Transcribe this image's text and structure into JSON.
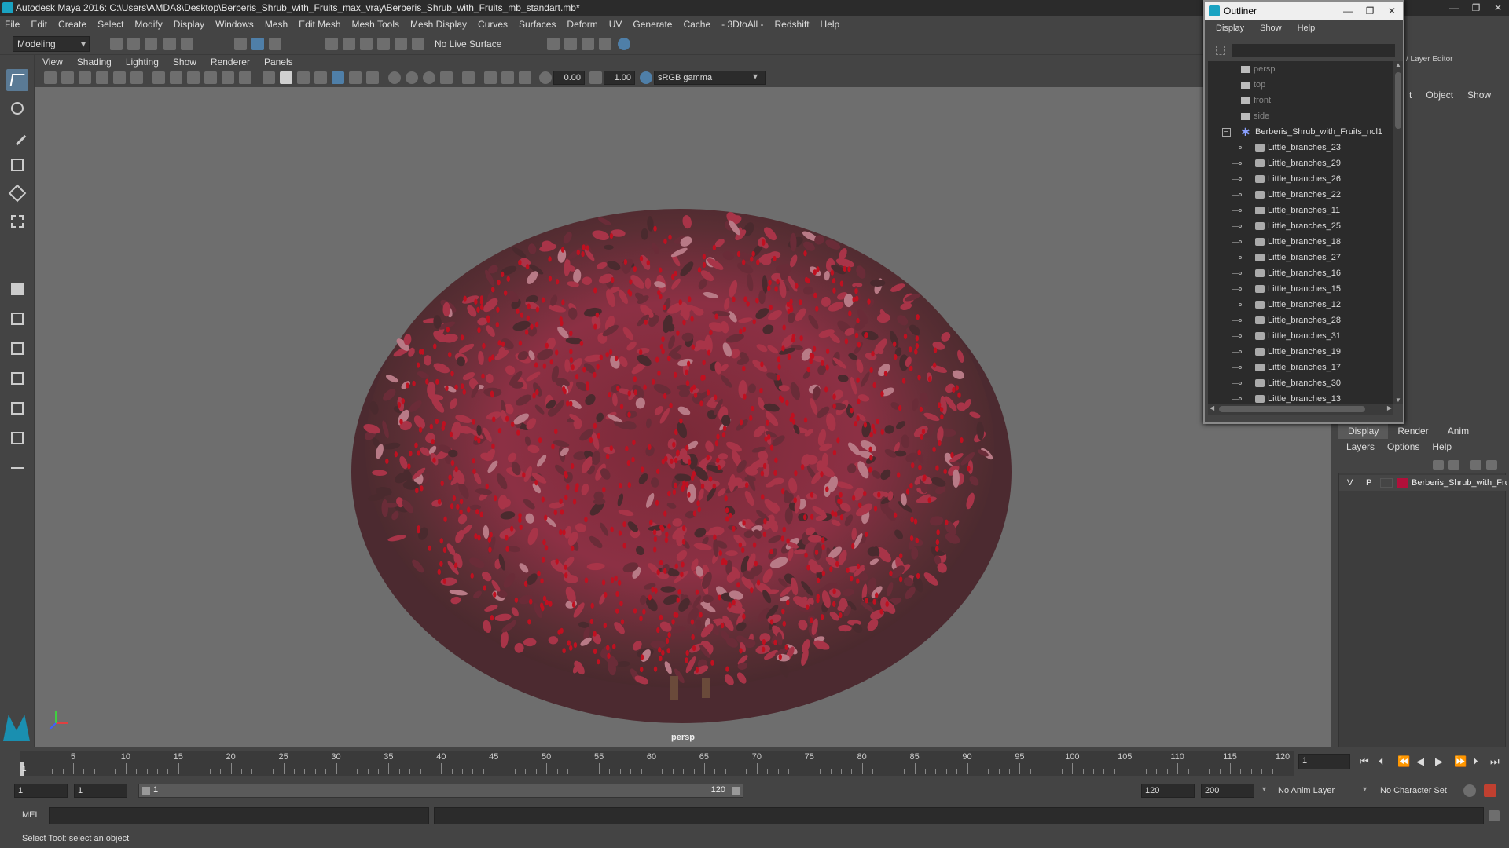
{
  "title": "Autodesk Maya 2016: C:\\Users\\AMDA8\\Desktop\\Berberis_Shrub_with_Fruits_max_vray\\Berberis_Shrub_with_Fruits_mb_standart.mb*",
  "window_controls": [
    "—",
    "❐",
    "✕"
  ],
  "menubar": [
    "File",
    "Edit",
    "Create",
    "Select",
    "Modify",
    "Display",
    "Windows",
    "Mesh",
    "Edit Mesh",
    "Mesh Tools",
    "Mesh Display",
    "Curves",
    "Surfaces",
    "Deform",
    "UV",
    "Generate",
    "Cache",
    "- 3DtoAll -",
    "Redshift",
    "Help"
  ],
  "status": {
    "mode": "Modeling",
    "live_surface": "No Live Surface"
  },
  "viewport_menu": [
    "View",
    "Shading",
    "Lighting",
    "Show",
    "Renderer",
    "Panels"
  ],
  "viewport_toolbar": {
    "near_value": "0.00",
    "gamma_value": "1.00",
    "color_space": "sRGB gamma"
  },
  "viewport": {
    "camera_label": "persp"
  },
  "outliner": {
    "title": "Outliner",
    "menu": [
      "Display",
      "Show",
      "Help"
    ],
    "cameras": [
      "persp",
      "top",
      "front",
      "side"
    ],
    "group": "Berberis_Shrub_with_Fruits_ncl1",
    "children": [
      "Little_branches_23",
      "Little_branches_29",
      "Little_branches_26",
      "Little_branches_22",
      "Little_branches_11",
      "Little_branches_25",
      "Little_branches_18",
      "Little_branches_27",
      "Little_branches_16",
      "Little_branches_15",
      "Little_branches_12",
      "Little_branches_28",
      "Little_branches_31",
      "Little_branches_19",
      "Little_branches_17",
      "Little_branches_30",
      "Little_branches_13"
    ]
  },
  "right_panel": {
    "layer_editor_label": "/ Layer Editor",
    "menu_top": [
      "t",
      "Object",
      "Show"
    ],
    "tabs": [
      "Display",
      "Render",
      "Anim"
    ],
    "layer_menu": [
      "Layers",
      "Options",
      "Help"
    ],
    "layer": {
      "v": "V",
      "p": "P",
      "name": "Berberis_Shrub_with_Fruits",
      "color": "#b0103a"
    }
  },
  "timeline": {
    "ticks": [
      5,
      10,
      15,
      20,
      25,
      30,
      35,
      40,
      45,
      50,
      55,
      60,
      65,
      70,
      75,
      80,
      85,
      90,
      95,
      100,
      105,
      110,
      115,
      120
    ],
    "start_marker": "1",
    "current_frame": "1"
  },
  "range": {
    "start": "1",
    "inner_start": "1",
    "slider_start": "1",
    "slider_end": "120",
    "end": "120",
    "anim_end": "200",
    "anim_layer": "No Anim Layer",
    "char_set": "No Character Set"
  },
  "cmd": {
    "lang": "MEL"
  },
  "help_line": "Select Tool: select an object",
  "colors": {
    "berry": "#c01020",
    "leaf": "#a83448",
    "dark_leaf": "#4a2a2e"
  }
}
